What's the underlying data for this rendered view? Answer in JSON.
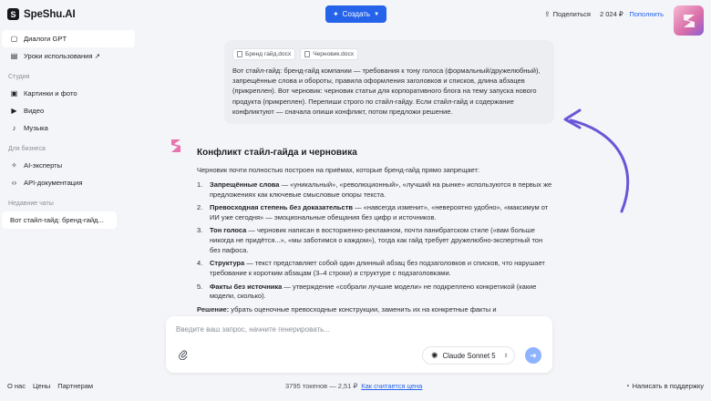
{
  "app": {
    "logo_letter": "S",
    "name": "SpeShu.AI",
    "create_label": "Создать",
    "share_label": "Поделиться",
    "balance": "2 024 ₽",
    "topup_label": "Пополнить"
  },
  "sidebar": {
    "top_items": [
      {
        "label": "Диалоги GPT",
        "icon": "chat-icon"
      },
      {
        "label": "Уроки использования ↗",
        "icon": "lessons-icon"
      }
    ],
    "studio": {
      "title": "Студия",
      "items": [
        {
          "label": "Картинки и фото",
          "icon": "image-icon"
        },
        {
          "label": "Видео",
          "icon": "video-icon"
        },
        {
          "label": "Музыка",
          "icon": "music-icon"
        }
      ]
    },
    "business": {
      "title": "Для бизнеса",
      "items": [
        {
          "label": "AI-эксперты",
          "icon": "experts-icon"
        },
        {
          "label": "API-документация",
          "icon": "api-icon"
        }
      ]
    },
    "recent": {
      "title": "Недавние чаты",
      "items": [
        {
          "label": "Вот стайл-гайд: бренд-гайд..."
        }
      ]
    },
    "footer": [
      "О нас",
      "Цены",
      "Партнерам"
    ]
  },
  "user_message": {
    "files": [
      "Бренд гайд.docx",
      "Черновик.docx"
    ],
    "text": "Вот стайл-гайд: бренд-гайд компании — требования к тону голоса (формальный/дружелюбный), запрещённые слова и обороты, правила оформления заголовков и списков, длина абзацев (прикреплен). Вот черновик: черновик статьи для корпоративного блога на тему запуска нового продукта (прикреплен). Перепиши строго по стайл-гайду. Если стайл-гайд и содержание конфликтуют — сначала опиши конфликт, потом предложи решение."
  },
  "answer": {
    "title": "Конфликт стайл-гайда и черновика",
    "intro": "Черновик почти полностью построен на приёмах, которые бренд-гайд прямо запрещает:",
    "items": [
      {
        "num": "1.",
        "bold": "Запрещённые слова",
        "text": " — «уникальный», «революционный», «лучший на рынке» используются в первых же предложениях как ключевые смысловые опоры текста."
      },
      {
        "num": "2.",
        "bold": "Превосходная степень без доказательств",
        "text": " — «навсегда изменит», «невероятно удобно», «максимум от ИИ уже сегодня» — эмоциональные обещания без цифр и источников."
      },
      {
        "num": "3.",
        "bold": "Тон голоса",
        "text": " — черновик написан в восторженно-рекламном, почти панибратском стиле («вам больше никогда не придётся...», «мы заботимся о каждом»), тогда как гайд требует дружелюбно-экспертный тон без пафоса."
      },
      {
        "num": "4.",
        "bold": "Структура",
        "text": " — текст представляет собой один длинный абзац без подзаголовков и списков, что нарушает требование к коротким абзацам (3–4 строки) и структуре с подзаголовками."
      },
      {
        "num": "5.",
        "bold": "Факты без источника",
        "text": " — утверждение «собрали лучшие модели» не подкреплено конкретикой (какие модели, сколько)."
      }
    ],
    "solution_bold": "Решение:",
    "solution_text": " убрать оценочные превосходные конструкции, заменить их на конкретные факты и"
  },
  "composer": {
    "placeholder": "Введите ваш запрос, начните генерировать...",
    "model_label": "Claude Sonnet 5"
  },
  "footer": {
    "tokens": "3795 токенов — 2,51 ₽",
    "how_link": "Как считается цена",
    "support": "Написать в поддержку"
  },
  "colors": {
    "accent": "#2563eb",
    "send_button": "#8fb4ff",
    "annotation_arrow": "#6a55d8"
  }
}
